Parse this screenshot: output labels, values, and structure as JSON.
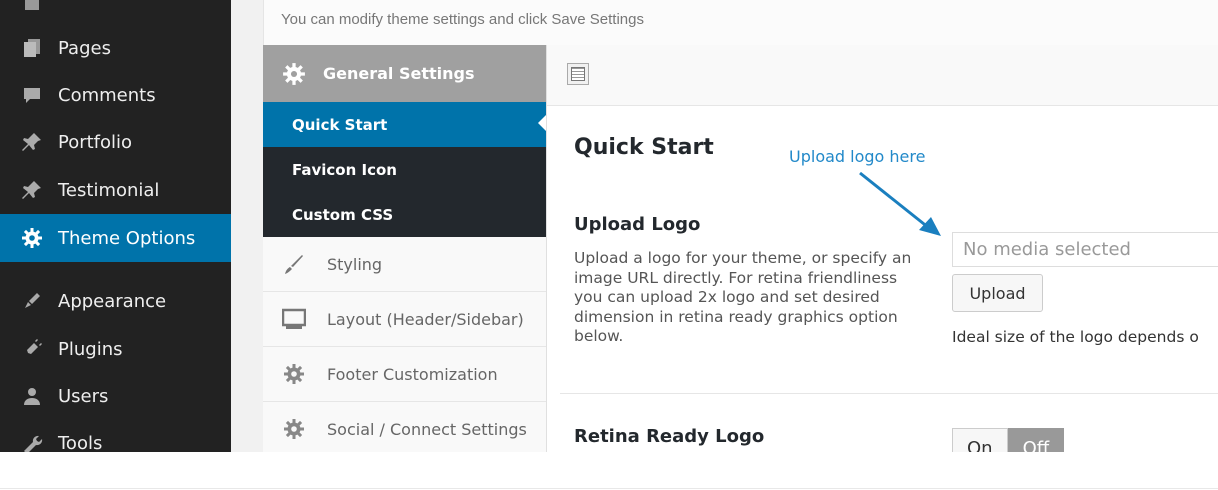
{
  "top_description": "You can modify theme settings and click Save Settings",
  "wp_menu": [
    {
      "label": "Pages",
      "icon": "pages-icon"
    },
    {
      "label": "Comments",
      "icon": "comments-icon"
    },
    {
      "label": "Portfolio",
      "icon": "pin-icon"
    },
    {
      "label": "Testimonial",
      "icon": "pin-icon"
    },
    {
      "label": "Theme Options",
      "icon": "gear-icon",
      "active": true
    },
    {
      "label": "Appearance",
      "icon": "brush-icon"
    },
    {
      "label": "Plugins",
      "icon": "plug-icon"
    },
    {
      "label": "Users",
      "icon": "user-icon"
    },
    {
      "label": "Tools",
      "icon": "wrench-icon"
    }
  ],
  "options_nav": {
    "general": "General Settings",
    "sub_items": [
      "Quick Start",
      "Favicon Icon",
      "Custom CSS"
    ],
    "items": [
      "Styling",
      "Layout (Header/Sidebar)",
      "Footer Customization",
      "Social / Connect Settings"
    ]
  },
  "panel": {
    "section_title": "Quick Start",
    "annotation": "Upload logo here",
    "upload_logo": {
      "label": "Upload Logo",
      "help": "Upload a logo for your theme, or specify an image URL directly. For retina friendliness you can upload 2x logo and set desired dimension in retina ready graphics option below.",
      "placeholder": "No media selected",
      "button": "Upload",
      "note": "Ideal size of the logo depends o"
    },
    "retina": {
      "label": "Retina Ready Logo",
      "on": "On",
      "off": "Off"
    }
  },
  "colors": {
    "admin_bar": "#222222",
    "active_blue": "#0073aa",
    "annotation_blue": "#2289c9",
    "nav_head": "#a0a0a0"
  }
}
